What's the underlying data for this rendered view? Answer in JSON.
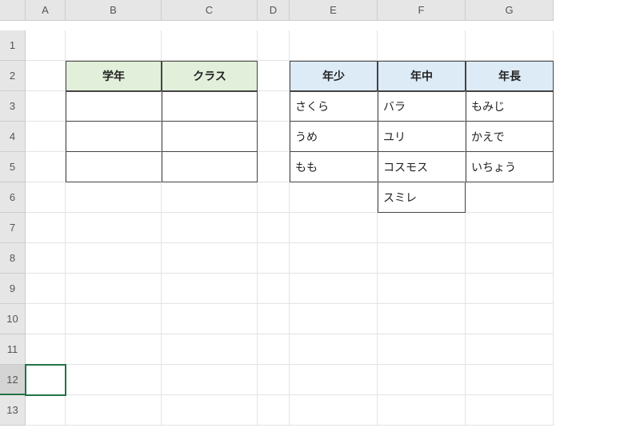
{
  "columns": [
    "A",
    "B",
    "C",
    "D",
    "E",
    "F",
    "G"
  ],
  "rows": [
    "1",
    "2",
    "3",
    "4",
    "5",
    "6",
    "7",
    "8",
    "9",
    "10",
    "11",
    "12",
    "13"
  ],
  "selected_row": "12",
  "left_table": {
    "headers": [
      "学年",
      "クラス"
    ],
    "rows": [
      [
        "",
        ""
      ],
      [
        "",
        ""
      ],
      [
        "",
        ""
      ]
    ]
  },
  "right_table": {
    "headers": [
      "年少",
      "年中",
      "年長"
    ],
    "data": {
      "col_E": [
        "さくら",
        "うめ",
        "もも"
      ],
      "col_F": [
        "バラ",
        "ユリ",
        "コスモス",
        "スミレ"
      ],
      "col_G": [
        "もみじ",
        "かえで",
        "いちょう"
      ]
    }
  }
}
